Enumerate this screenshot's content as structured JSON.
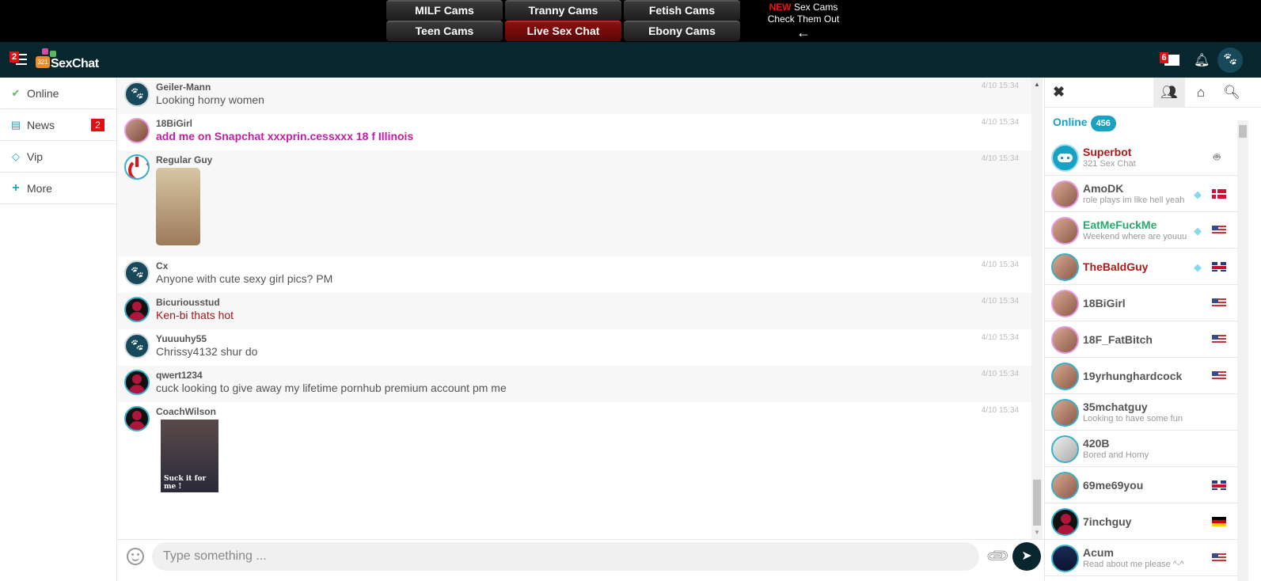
{
  "topbar": {
    "cam_links": [
      "MILF Cams",
      "Tranny Cams",
      "Fetish Cams",
      "Teen Cams",
      "Live Sex Chat",
      "Ebony Cams"
    ],
    "active_link": "Live Sex Chat",
    "promo": {
      "new_label": "NEW",
      "line1": "Sex Cams",
      "line2": "Check Them Out",
      "arrow": "←"
    }
  },
  "header": {
    "menu_badge": "2",
    "logo_text": "SexChat",
    "logo_bubble": "321",
    "mail_badge": "6",
    "icons": [
      "menu-icon",
      "mail-icon",
      "bell-icon",
      "paw-icon"
    ]
  },
  "leftnav": {
    "items": [
      {
        "label": "Online",
        "icon": "check-circle-icon"
      },
      {
        "label": "News",
        "icon": "newspaper-icon",
        "badge": "2"
      },
      {
        "label": "Vip",
        "icon": "diamond-icon"
      },
      {
        "label": "More",
        "icon": "plus-icon"
      }
    ]
  },
  "chat": {
    "messages": [
      {
        "user": "Geiler-Mann",
        "text": "Looking horny women",
        "time": "4/10 15:34",
        "avatar": "paw"
      },
      {
        "user": "18BiGirl",
        "text": "add me on Snapchat xxxprin.cessxxx 18 f Illinois",
        "time": "4/10 15:34",
        "avatar": "photo"
      },
      {
        "user": "Regular Guy",
        "text": "",
        "time": "4/10 15:34",
        "avatar": "power",
        "attachment": "image"
      },
      {
        "user": "Cx",
        "text": "Anyone with cute sexy girl pics? PM",
        "time": "4/10 15:34",
        "avatar": "paw"
      },
      {
        "user": "Bicuriousstud",
        "text": "Ken-bi thats hot",
        "time": "4/10 15:34",
        "avatar": "person"
      },
      {
        "user": "Yuuuuhy55",
        "text": "Chrissy4132 shur do",
        "time": "4/10 15:34",
        "avatar": "paw"
      },
      {
        "user": "qwert1234",
        "text": "cuck looking to give away my lifetime pornhub premium account pm me",
        "time": "4/10 15:34",
        "avatar": "person"
      },
      {
        "user": "CoachWilson",
        "text": "",
        "time": "4/10 15:34",
        "avatar": "person",
        "attachment": "image",
        "attachment_caption": "Suck it for me !"
      }
    ]
  },
  "composer": {
    "placeholder": "Type something ...",
    "value": ""
  },
  "rightpanel": {
    "online_label": "Online",
    "online_count": "456",
    "users": [
      {
        "name": "Superbot",
        "status": "321 Sex Chat",
        "device": "android"
      },
      {
        "name": "AmoDK",
        "status": "role plays im like hell yeah",
        "vip": true,
        "flag": "DK"
      },
      {
        "name": "EatMeFuckMe",
        "status": "Weekend where are youuu",
        "vip": true,
        "flag": "US"
      },
      {
        "name": "TheBaldGuy",
        "status": "",
        "vip": true,
        "flag": "GB"
      },
      {
        "name": "18BiGirl",
        "status": "",
        "flag": "US"
      },
      {
        "name": "18F_FatBitch",
        "status": "",
        "flag": "US"
      },
      {
        "name": "19yrhunghardcock",
        "status": "",
        "flag": "US"
      },
      {
        "name": "35mchatguy",
        "status": "Looking to have some fun"
      },
      {
        "name": "420B",
        "status": "Bored and Horny"
      },
      {
        "name": "69me69you",
        "status": "",
        "flag": "GB"
      },
      {
        "name": "7inchguy",
        "status": "",
        "flag": "DE"
      },
      {
        "name": "Acum",
        "status": "Read about me please ^-^",
        "flag": "US"
      }
    ]
  },
  "colors": {
    "header_bg": "#07262d",
    "accent": "#17a2c4",
    "badge_red": "#e01010",
    "active_link": "#8c1010"
  }
}
